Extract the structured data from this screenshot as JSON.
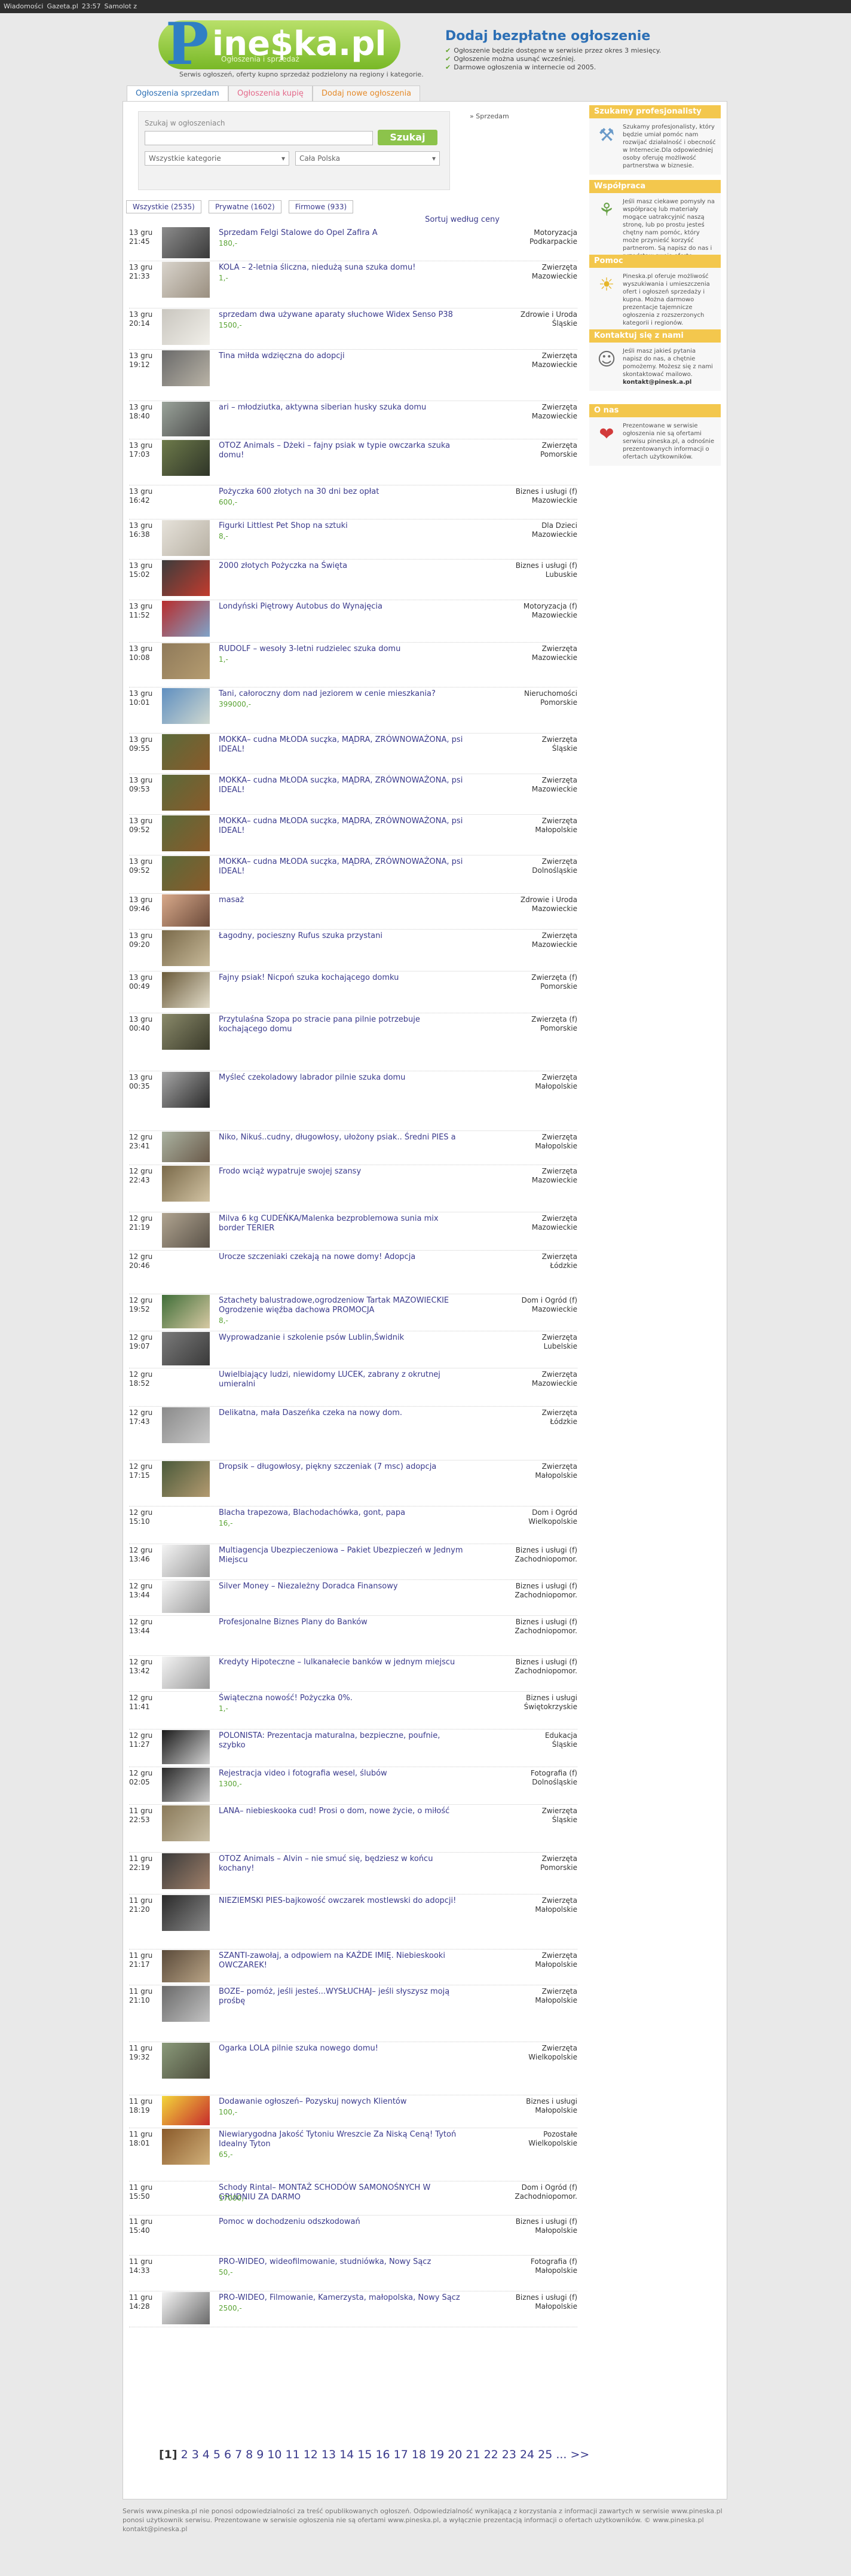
{
  "topbar": [
    "Wiadomości",
    "Gazeta.pl",
    "23:57",
    "Samolot z"
  ],
  "header": {
    "logo_p": "P",
    "logo_rest": "ine$ka.pl",
    "logo_sub": "Ogłoszenia i sprzedaż",
    "logo_desc": "Serwis ogłoszeń, oferty kupno sprzedaż podzielony na regiony i kategorie.",
    "add_title": "Dodaj bezpłatne ogłoszenie",
    "add_points": [
      "Ogłoszenie będzie dostępne w serwisie przez okres 3 miesięcy.",
      "Ogłoszenie można usunąć wcześniej.",
      "Darmowe ogłoszenia w internecie od 2005."
    ]
  },
  "tabs": [
    "Ogłoszenia sprzedam",
    "Ogłoszenia kupię",
    "Dodaj nowe ogłoszenia"
  ],
  "search": {
    "label": "Szukaj w ogłoszeniach",
    "button": "Szukaj",
    "category": "Wszystkie kategorie",
    "region": "Cała Polska"
  },
  "breadcrumb": "» Sprzedam",
  "filters": [
    "Wszystkie (2535)",
    "Prywatne (1602)",
    "Firmowe (933)"
  ],
  "sort_label": "Sortuj według ceny",
  "sidebar": [
    {
      "head": "Szukamy profesjonalisty",
      "body": "Szukamy profesjonalisty, który będzie umiał pomóc nam rozwijać działalność i obecność w Internecie.Dla odpowiedniej osoby oferuję możliwość partnerstwa w biznesie.",
      "icon": "tools-icon"
    },
    {
      "head": "Współpraca",
      "body": "Jeśli masz ciekawe pomysły na współpracę lub materiały mogące uatrakcyjnić naszą stronę, lub po prostu jesteś chętny nam pomóc, który może przynieść korzyść partnerom. Są napisz do nas i przedstaw swoją ofertę współpracy.",
      "icon": "plant-icon"
    },
    {
      "head": "Pomoc",
      "body": "Pineska.pl oferuje możliwość wyszukiwania i umieszczenia ofert i ogłoszeń sprzedaży i kupna. Można darmowo prezentacje tajemnicze ogłoszenia z rozszerzonych kategorii i regionów.",
      "icon": "bulb-icon"
    },
    {
      "head": "Kontaktuj się z nami",
      "body": "Jeśli masz jakieś pytania napisz do nas, a chętnie pomożemy. Możesz się z nami skontaktować mailowo.",
      "email": "kontakt@pinesk.a.pl",
      "icon": "people-icon"
    },
    {
      "head": "O nas",
      "body": "Prezentowane w serwisie ogłoszenia nie są ofertami serwisu pineska.pl, a odnośnie prezentowanych informacji o ofertach użytkowników.",
      "icon": "pin-icon"
    }
  ],
  "listings": [
    {
      "date": "13 gru 21:45",
      "title": "Sprzedam Felgi Stalowe do Opel Zafira A",
      "price": "180,-",
      "cat": "Motoryzacja",
      "region": "Podkarpackie",
      "thumb": "#8c8c8c",
      "thumb2": "#3a3a3a",
      "h": 58
    },
    {
      "date": "13 gru 21:33",
      "title": "KOLA – 2-letnia śliczna, niedużą suna szuka domu!",
      "price": "1,-",
      "cat": "Zwierzęta",
      "region": "Mazowieckie",
      "thumb": "#d9d4cc",
      "thumb2": "#9a8f80",
      "h": 79
    },
    {
      "date": "13 gru 20:14",
      "title": "sprzedam dwa używane aparaty słuchowe Widex Senso P38",
      "price": "1500,-",
      "cat": "Zdrowie i Uroda",
      "region": "Śląskie",
      "thumb": "#c9c6bf",
      "thumb2": "#f1efe9",
      "h": 69
    },
    {
      "date": "13 gru 19:12",
      "title": "Tina miłda wdzięczna do adopcji",
      "price": "",
      "cat": "Zwierzęta",
      "region": "Mazowieckie",
      "thumb": "#6a6a6a",
      "thumb2": "#b9b3a6",
      "h": 86
    },
    {
      "date": "13 gru 18:40",
      "title": "ari – młodziutka, aktywna siberian husky szuka domu",
      "price": "",
      "cat": "Zwierzęta",
      "region": "Mazowieckie",
      "thumb": "#9aa39a",
      "thumb2": "#4a4a4a",
      "h": 64
    },
    {
      "date": "13 gru 17:03",
      "title": "OTOZ Animals – Dżeki – fajny psiak w typie owczarka szuka domu!",
      "price": "",
      "cat": "Zwierzęta",
      "region": "Pomorskie",
      "thumb": "#6d7a4a",
      "thumb2": "#2f3528",
      "h": 77
    },
    {
      "date": "13 gru 16:42",
      "title": "Pożyczka 600 złotych na 30 dni bez opłat",
      "price": "600,-",
      "cat": "Biznes i usługi (f)",
      "region": "Mazowieckie",
      "thumb": "#ffffff",
      "thumb2": "#ffffff",
      "h": 57
    },
    {
      "date": "13 gru 16:38",
      "title": "Figurki Littlest Pet Shop na sztuki",
      "price": "8,-",
      "cat": "Dla Dzieci",
      "region": "Mazowieckie",
      "thumb": "#e6e2da",
      "thumb2": "#b8b1a4",
      "h": 67
    },
    {
      "date": "13 gru 15:02",
      "title": "2000 złotych Pożyczka na Święta",
      "price": "",
      "cat": "Biznes i usługi (f)",
      "region": "Lubuskie",
      "thumb": "#3c3c3c",
      "thumb2": "#c23b2e",
      "h": 68
    },
    {
      "date": "13 gru 11:52",
      "title": "Londyński Piętrowy Autobus do Wynajęcia",
      "price": "",
      "cat": "Motoryzacja (f)",
      "region": "Mazowieckie",
      "thumb": "#b82c2c",
      "thumb2": "#7fa3c9",
      "h": 71
    },
    {
      "date": "13 gru 10:08",
      "title": "RUDOLF – wesoły 3-letni rudzielec szuka domu",
      "price": "1,-",
      "cat": "Zwierzęta",
      "region": "Mazowieckie",
      "thumb": "#8f7a5a",
      "thumb2": "#b59c70",
      "h": 75
    },
    {
      "date": "13 gru 10:01",
      "title": "Tani, całoroczny dom nad jeziorem w cenie mieszkania?",
      "price": "399000,-",
      "cat": "Nieruchomości",
      "region": "Pomorskie",
      "thumb": "#5f8fc0",
      "thumb2": "#cfd8d0",
      "h": 77
    },
    {
      "date": "13 gru 09:55",
      "title": "MOKKA– cudna MŁODA sucz̨ka, MĄDRA, ZRÓWNOWAŻONA, psi IDEAL!",
      "price": "",
      "cat": "Zwierzęta",
      "region": "Śląskie",
      "thumb": "#5a6a3a",
      "thumb2": "#8a5a2a",
      "h": 68
    },
    {
      "date": "13 gru 09:53",
      "title": "MOKKA– cudna MŁODA sucz̨ka, MĄDRA, ZRÓWNOWAŻONA, psi IDEAL!",
      "price": "",
      "cat": "Zwierzęta",
      "region": "Mazowieckie",
      "thumb": "#5a6a3a",
      "thumb2": "#8a5a2a",
      "h": 68
    },
    {
      "date": "13 gru 09:52",
      "title": "MOKKA– cudna MŁODA sucz̨ka, MĄDRA, ZRÓWNOWAŻONA, psi IDEAL!",
      "price": "",
      "cat": "Zwierzęta",
      "region": "Małopolskie",
      "thumb": "#5a6a3a",
      "thumb2": "#8a5a2a",
      "h": 68
    },
    {
      "date": "13 gru 09:52",
      "title": "MOKKA– cudna MŁODA sucz̨ka, MĄDRA, ZRÓWNOWAŻONA, psi IDEAL!",
      "price": "",
      "cat": "Zwierzęta",
      "region": "Dolnośląskie",
      "thumb": "#5a6a3a",
      "thumb2": "#8a5a2a",
      "h": 64
    },
    {
      "date": "13 gru 09:46",
      "title": "masaż",
      "price": "",
      "cat": "Zdrowie i Uroda",
      "region": "Mazowieckie",
      "thumb": "#d8a98a",
      "thumb2": "#6b4a3a",
      "h": 60
    },
    {
      "date": "13 gru 09:20",
      "title": "Łagodny, pocieszny Rufus szuka przystani",
      "price": "",
      "cat": "Zwierzęta",
      "region": "Mazowieckie",
      "thumb": "#7a6a4a",
      "thumb2": "#c7b999",
      "h": 70
    },
    {
      "date": "13 gru 00:49",
      "title": "Fajny psiak! Nicpoń szuka kochającego domku",
      "price": "",
      "cat": "Zwierzęta (f)",
      "region": "Pomorskie",
      "thumb": "#6a5a3a",
      "thumb2": "#e2dcc9",
      "h": 70
    },
    {
      "date": "13 gru 00:40",
      "title": "Przytulaśna Szopa po stracie pana pilnie potrzebuje kochającego domu",
      "price": "",
      "cat": "Zwierzęta (f)",
      "region": "Pomorskie",
      "thumb": "#8a8a6a",
      "thumb2": "#3a3a2a",
      "h": 97
    },
    {
      "date": "13 gru 00:35",
      "title": "Myśleć czekoladowy labrador pilnie szuka domu",
      "price": "",
      "cat": "Zwierzęta",
      "region": "Małopolskie",
      "thumb": "#a5a5a5",
      "thumb2": "#2a2a2a",
      "h": 100
    },
    {
      "date": "12 gru 23:41",
      "title": "Niko, Nikuś..cudny, długowłosy, ułożony psiak.. Średni PIES a",
      "price": "",
      "cat": "Zwierzęta",
      "region": "Małopolskie",
      "thumb": "#aab2a0",
      "thumb2": "#6a5a4a",
      "h": 57
    },
    {
      "date": "12 gru 22:43",
      "title": "Frodo wciąż wypatruje swojej szansy",
      "price": "",
      "cat": "Zwierzęta",
      "region": "Mazowieckie",
      "thumb": "#7a6a4a",
      "thumb2": "#d2c3a3",
      "h": 79
    },
    {
      "date": "12 gru 21:19",
      "title": "Milva 6 kg CUDEŃKA/Malenka bezproblemowa sunia mix border TERIER",
      "price": "",
      "cat": "Zwierzęta",
      "region": "Mazowieckie",
      "thumb": "#b0a490",
      "thumb2": "#5a5248",
      "h": 64
    },
    {
      "date": "12 gru 20:46",
      "title": "Urocze szczeniaki czekają na nowe domy! Adopcja",
      "price": "",
      "cat": "Zwierzęta",
      "region": "Łódzkie",
      "thumb": "#ffffff",
      "thumb2": "#ffffff",
      "h": 73
    },
    {
      "date": "12 gru 19:52",
      "title": "Sztachety balustradowe,ogrodzeniow Tartak MAZOWIECKIE Ogrodzenie więźba dachowa PROMOCJA",
      "price": "8,-",
      "cat": "Dom i Ogród (f)",
      "region": "Mazowieckie",
      "thumb": "#3f6e38",
      "thumb2": "#d7c9a3",
      "h": 62
    },
    {
      "date": "12 gru 19:07",
      "title": "Wyprowadzanie i szkolenie psów Lublin,Świdnik",
      "price": "",
      "cat": "Zwierzęta",
      "region": "Lubelskie",
      "thumb": "#7a7a7a",
      "thumb2": "#3a3a3a",
      "h": 62
    },
    {
      "date": "12 gru 18:52",
      "title": "Uwielbiający ludzi, niewidomy LUCEK, zabrany z okrutnej umieralni",
      "price": "",
      "cat": "Zwierzęta",
      "region": "Mazowieckie",
      "thumb": "#ffffff",
      "thumb2": "#ffffff",
      "h": 64
    },
    {
      "date": "12 gru 17:43",
      "title": "Delikatna, mała Daszeńka czeka na nowy dom.",
      "price": "",
      "cat": "Zwierzęta",
      "region": "Łódzkie",
      "thumb": "#8a8a8a",
      "thumb2": "#c9c9c9",
      "h": 90
    },
    {
      "date": "12 gru 17:15",
      "title": "Dropsik – długowłosy, piękny szczeniak (7 msc) adopcja",
      "price": "",
      "cat": "Zwierzęta",
      "region": "Małopolskie",
      "thumb": "#4a5a3a",
      "thumb2": "#b39a70",
      "h": 77
    },
    {
      "date": "12 gru 15:10",
      "title": "Blacha trapezowa, Blachodachówka, gont, papa",
      "price": "16,-",
      "cat": "Dom i Ogród",
      "region": "Wielkopolskie",
      "thumb": "#ffffff",
      "thumb2": "#ffffff",
      "h": 63
    },
    {
      "date": "12 gru 13:46",
      "title": "Multiagencja Ubezpieczeniowa – Pakiet Ubezpieczeń w Jednym Miejscu",
      "price": "",
      "cat": "Biznes i usługi (f)",
      "region": "Zachodniopomor.",
      "thumb": "#f4f4f4",
      "thumb2": "#9a9a9a",
      "h": 60
    },
    {
      "date": "12 gru 13:44",
      "title": "Silver Money – Niezależny Doradca Finansowy",
      "price": "",
      "cat": "Biznes i usługi (f)",
      "region": "Zachodniopomor.",
      "thumb": "#f4f4f4",
      "thumb2": "#9a9a9a",
      "h": 60
    },
    {
      "date": "12 gru 13:44",
      "title": "Profesjonalne Biznes Plany do Banków",
      "price": "",
      "cat": "Biznes i usługi (f)",
      "region": "Zachodniopomor.",
      "thumb": "#ffffff",
      "thumb2": "#ffffff",
      "h": 67
    },
    {
      "date": "12 gru 13:42",
      "title": "Kredyty Hipoteczne – lulkanałecie banków w jednym miejscu",
      "price": "",
      "cat": "Biznes i usługi (f)",
      "region": "Zachodniopomor.",
      "thumb": "#f4f4f4",
      "thumb2": "#9a9a9a",
      "h": 60
    },
    {
      "date": "12 gru 11:41",
      "title": "Świąteczna nowość! Pożyczka 0%.",
      "price": "1,-",
      "cat": "Biznes i usługi",
      "region": "Świętokrzyskie",
      "thumb": "#ffffff",
      "thumb2": "#ffffff",
      "h": 63
    },
    {
      "date": "12 gru 11:27",
      "title": "POLONISTA: Prezentacja maturalna, bezpieczne, poufnie, szybko",
      "price": "",
      "cat": "Edukacja",
      "region": "Śląskie",
      "thumb": "#1a1a1a",
      "thumb2": "#d4d4d4",
      "h": 63
    },
    {
      "date": "12 gru 02:05",
      "title": "Rejestracja video i fotografia wesel, ślubów",
      "price": "1300,-",
      "cat": "Fotografia (f)",
      "region": "Dolnośląskie",
      "thumb": "#2a2a2a",
      "thumb2": "#c9c9c9",
      "h": 63
    },
    {
      "date": "11 gru 22:53",
      "title": "LANA– niebieskooka cud! Prosi o dom, nowe życie, o miłość",
      "price": "",
      "cat": "Zwierzęta",
      "region": "Śląskie",
      "thumb": "#8a7a5a",
      "thumb2": "#c9bfa6",
      "h": 80
    },
    {
      "date": "11 gru 22:19",
      "title": "OTOZ Animals – Alvin – nie smuć się, będziesz w końcu kochany!",
      "price": "",
      "cat": "Zwierzęta",
      "region": "Pomorskie",
      "thumb": "#3a3a3a",
      "thumb2": "#a0806a",
      "h": 70
    },
    {
      "date": "11 gru 21:20",
      "title": "NIEZIEMSKI PIES-bajkowość owczarek mostlewski do adopcji!",
      "price": "",
      "cat": "Zwierzęta",
      "region": "Małopolskie",
      "thumb": "#2a2a2a",
      "thumb2": "#8a8a8a",
      "h": 92
    },
    {
      "date": "11 gru 21:17",
      "title": "SZANTI-zawołaj, a odpowiem na KAŻDE IMIĘ. Niebieskooki OWCZAREK!",
      "price": "",
      "cat": "Zwierzęta",
      "region": "Małopolskie",
      "thumb": "#5a4a3a",
      "thumb2": "#b9a486",
      "h": 60
    },
    {
      "date": "11 gru 21:10",
      "title": "BOZE– pomóż, jeśli jesteś...WYSŁUCHAJ– jeśli słyszysz moją prośbę",
      "price": "",
      "cat": "Zwierzęta",
      "region": "Małopolskie",
      "thumb": "#6a6a6a",
      "thumb2": "#c3c3c3",
      "h": 95
    },
    {
      "date": "11 gru 19:32",
      "title": "Ogarka LOLA pilnie szuka nowego domu!",
      "price": "",
      "cat": "Zwierzęta",
      "region": "Wielkopolskie",
      "thumb": "#8a9a7a",
      "thumb2": "#4a4a3a",
      "h": 89
    },
    {
      "date": "11 gru 18:19",
      "title": "Dodawanie ogłoszeń– Pozyskuj nowych Klientów",
      "price": "100,-",
      "cat": "Biznes i usługi",
      "region": "Małopolskie",
      "thumb": "#f2d53a",
      "thumb2": "#c72c2c",
      "h": 55
    },
    {
      "date": "11 gru 18:01",
      "title": "Niewiarygodna Jakość Tytoniu Wreszcie Za Niską Ceną! Tytoń Idealny Tyton",
      "price": "65,-",
      "cat": "Pozostałe",
      "region": "Wielkopolskie",
      "thumb": "#8a5a2a",
      "thumb2": "#d1b07a",
      "h": 89
    },
    {
      "date": "11 gru 15:50",
      "title": "Schody Rintal– MONTAŻ SCHODÓW SAMONOŚNYCH W GRUDNIU ZA DARMO",
      "price": "17000,-",
      "cat": "Dom i Ogród (f)",
      "region": "Zachodniopomor.",
      "thumb": "#ffffff",
      "thumb2": "#ffffff",
      "h": 57
    },
    {
      "date": "11 gru 15:40",
      "title": "Pomoc w dochodzeniu odszkodowań",
      "price": "",
      "cat": "Biznes i usługi (f)",
      "region": "Małopolskie",
      "thumb": "#ffffff",
      "thumb2": "#ffffff",
      "h": 67
    },
    {
      "date": "11 gru 14:33",
      "title": "PRO-WIDEO, wideofilmowanie, studniówka, Nowy Sącz",
      "price": "50,-",
      "cat": "Fotografia (f)",
      "region": "Małopolskie",
      "thumb": "#ffffff",
      "thumb2": "#ffffff",
      "h": 60
    },
    {
      "date": "11 gru 14:28",
      "title": "PRO-WIDEO, Filmowanie, Kamerzysta, małopolska, Nowy Sącz",
      "price": "2500,-",
      "cat": "Biznes i usługi (f)",
      "region": "Małopolskie",
      "thumb": "#f4f4f4",
      "thumb2": "#6a6a6a",
      "h": 60
    }
  ],
  "pager": {
    "current": "[1]",
    "pages": [
      "2",
      "3",
      "4",
      "5",
      "6",
      "7",
      "8",
      "9",
      "10",
      "11",
      "12",
      "13",
      "14",
      "15",
      "16",
      "17",
      "18",
      "19",
      "20",
      "21",
      "22",
      "23",
      "24",
      "25",
      "...",
      ">>"
    ]
  },
  "footer": {
    "line1": "Serwis www.pineska.pl nie ponosi odpowiedzialności za treść opublikowanych ogłoszeń. Odpowiedzialność wynikającą z korzystania z informacji zawartych w serwisie www.pineska.pl ponosi użytkownik serwisu. Prezentowane w serwisie ogłoszenia nie są ofertami www.pineska.pl, a wyłącznie prezentacją informacji o ofertach użytkowników. © www.pineska.pl",
    "line2": "kontakt@pineska.pl"
  },
  "colors": {
    "accent": "#2c6fb5",
    "green": "#8cc34b",
    "sidebar": "#f3c74d",
    "link": "#3a3a8c"
  }
}
